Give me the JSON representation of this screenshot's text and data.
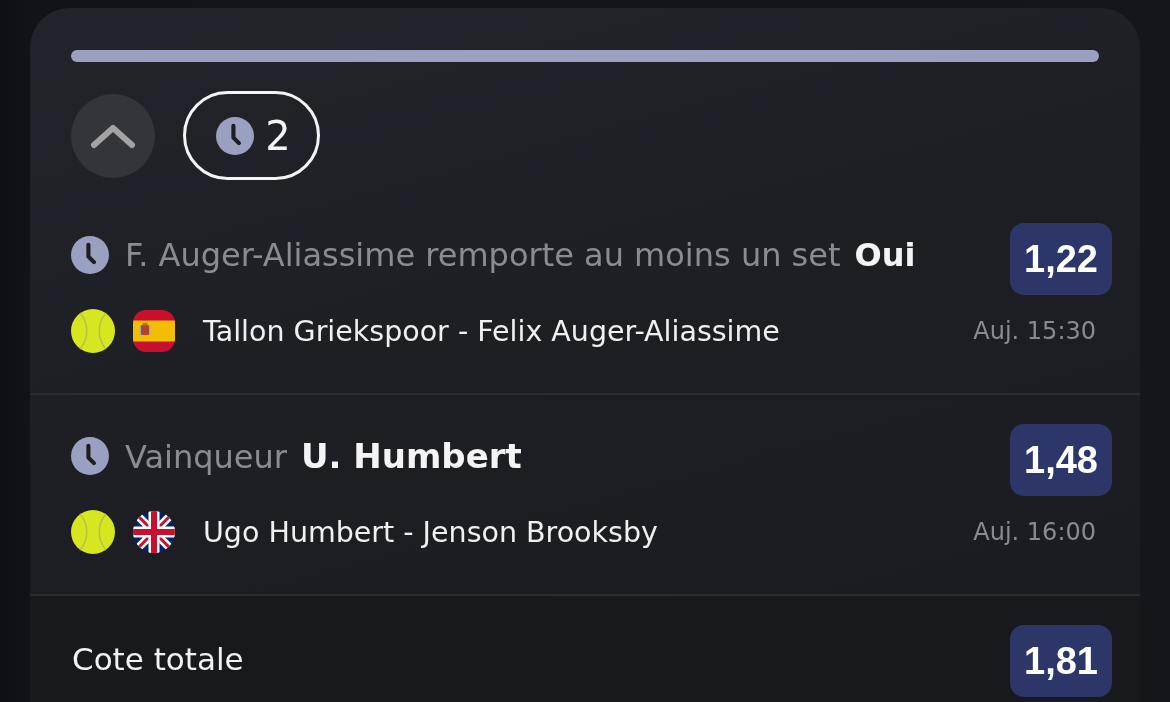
{
  "toolbar": {
    "collapse": {
      "expanded": true
    },
    "pending_filter": {
      "count": "2"
    }
  },
  "bets": [
    {
      "market": "F. Auger-Aliassime remporte au moins un set",
      "selection": "Oui",
      "odds": "1,22",
      "flag": {
        "kind": "es"
      },
      "match": "Tallon Griekspoor - Felix Auger-Aliassime",
      "time": "Auj. 15:30"
    },
    {
      "market": "Vainqueur",
      "selection": "U. Humbert",
      "odds": "1,48",
      "flag": {
        "kind": "gb"
      },
      "match": "Ugo Humbert - Jenson Brooksby",
      "time": "Auj. 16:00"
    }
  ],
  "total": {
    "label": "Cote totale",
    "odds": "1,81"
  }
}
